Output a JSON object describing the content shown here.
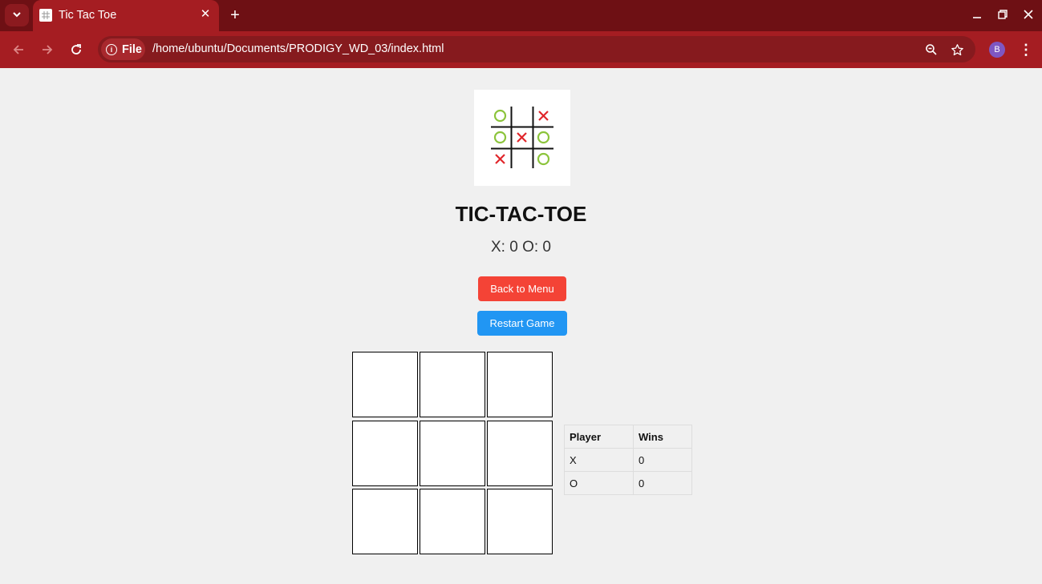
{
  "browser": {
    "tab_title": "Tic Tac Toe",
    "site_info_label": "File",
    "url": "/home/ubuntu/Documents/PRODIGY_WD_03/index.html",
    "profile_initial": "B"
  },
  "game": {
    "title": "TIC-TAC-TOE",
    "score_text": "X: 0 O: 0",
    "back_button": "Back to Menu",
    "restart_button": "Restart Game",
    "board": [
      "",
      "",
      "",
      "",
      "",
      "",
      "",
      "",
      ""
    ]
  },
  "scoreboard": {
    "headers": [
      "Player",
      "Wins"
    ],
    "rows": [
      {
        "player": "X",
        "wins": "0"
      },
      {
        "player": "O",
        "wins": "0"
      }
    ]
  },
  "colors": {
    "chrome_dark": "#6e1014",
    "chrome_accent": "#a51d22",
    "back_button": "#f44336",
    "restart_button": "#2196f3",
    "logo_o": "#8cc43c",
    "logo_x": "#e0262b"
  }
}
